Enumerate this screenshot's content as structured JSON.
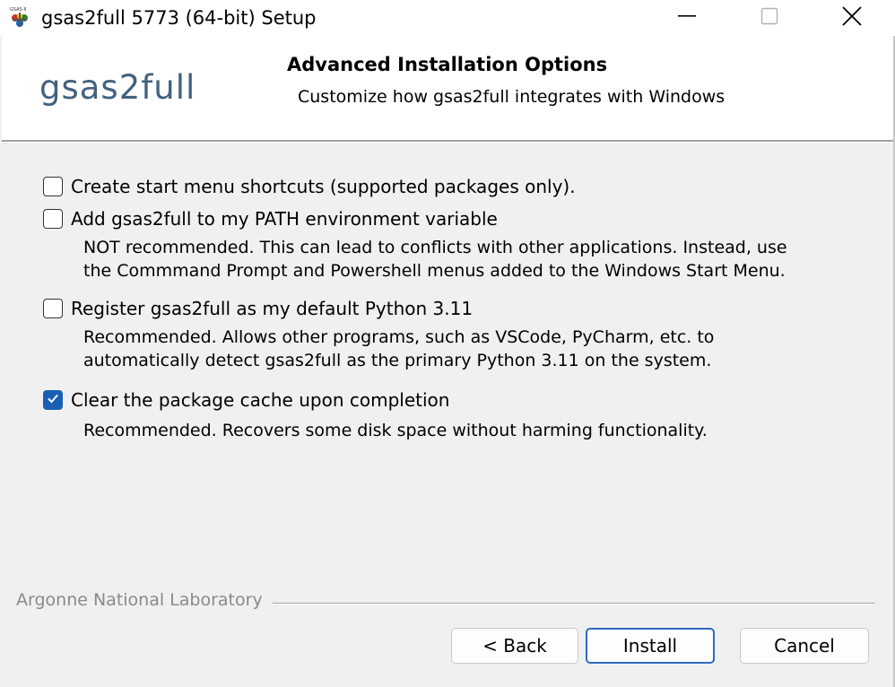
{
  "window": {
    "title": "gsas2full 5773 (64-bit) Setup"
  },
  "header": {
    "brand": "gsas2full",
    "title": "Advanced Installation Options",
    "subtitle": "Customize how gsas2full integrates with Windows"
  },
  "options": [
    {
      "label": "Create start menu shortcuts (supported packages only).",
      "checked": false,
      "description": []
    },
    {
      "label": "Add gsas2full to my PATH environment variable",
      "checked": false,
      "description": [
        "NOT recommended. This can lead to conflicts with other applications. Instead, use",
        "the Commmand Prompt and Powershell menus added to the Windows Start Menu."
      ]
    },
    {
      "label": "Register gsas2full as my default Python 3.11",
      "checked": false,
      "description": [
        "Recommended. Allows other programs, such as VSCode, PyCharm, etc. to",
        "automatically detect gsas2full as the primary Python 3.11 on the system."
      ]
    },
    {
      "label": "Clear the package cache upon completion",
      "checked": true,
      "description": [
        "Recommended. Recovers some disk space without harming functionality."
      ]
    }
  ],
  "footer": {
    "vendor": "Argonne National Laboratory",
    "back_label": "< Back",
    "install_label": "Install",
    "cancel_label": "Cancel"
  },
  "colors": {
    "brand_text": "#43617f",
    "checkbox_accent": "#1a5fb4",
    "default_button_border": "#2f6ac2"
  },
  "icons": {
    "app": "gsas-app-icon",
    "minimize": "minimize-icon",
    "maximize": "maximize-icon",
    "close": "close-icon",
    "check": "checkmark-icon"
  }
}
